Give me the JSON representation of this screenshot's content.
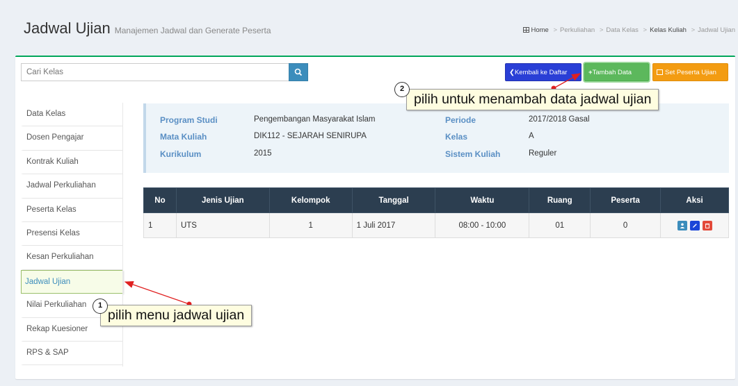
{
  "header": {
    "title": "Jadwal Ujian",
    "subtitle": "Manajemen Jadwal dan Generate Peserta",
    "breadcrumb": [
      "Home",
      "Perkuliahan",
      "Data Kelas",
      "Kelas Kuliah",
      "Jadwal Ujian"
    ],
    "breadcrumb_sep": ">"
  },
  "search": {
    "placeholder": "Cari Kelas"
  },
  "toolbar": {
    "back_label": "Kembali ke Daftar",
    "add_label": "Tambah Data",
    "set_label": "Set Peserta Ujian"
  },
  "sidebar": {
    "items": [
      {
        "label": "Data Kelas"
      },
      {
        "label": "Dosen Pengajar"
      },
      {
        "label": "Kontrak Kuliah"
      },
      {
        "label": "Jadwal Perkuliahan"
      },
      {
        "label": "Peserta Kelas"
      },
      {
        "label": "Presensi Kelas"
      },
      {
        "label": "Kesan Perkuliahan"
      },
      {
        "label": "Jadwal Ujian"
      },
      {
        "label": "Nilai Perkuliahan"
      },
      {
        "label": "Rekap Kuesioner"
      },
      {
        "label": "RPS & SAP"
      }
    ],
    "active_index": 7
  },
  "info": {
    "program_studi": {
      "label": "Program Studi",
      "value": "Pengembangan Masyarakat Islam"
    },
    "mata_kuliah": {
      "label": "Mata Kuliah",
      "value": "DIK112 - SEJARAH SENIRUPA"
    },
    "kurikulum": {
      "label": "Kurikulum",
      "value": "2015"
    },
    "periode": {
      "label": "Periode",
      "value": "2017/2018 Gasal"
    },
    "kelas": {
      "label": "Kelas",
      "value": "A"
    },
    "sistem_kuliah": {
      "label": "Sistem Kuliah",
      "value": "Reguler"
    }
  },
  "table": {
    "headers": [
      "No",
      "Jenis Ujian",
      "Kelompok",
      "Tanggal",
      "Waktu",
      "Ruang",
      "Peserta",
      "Aksi"
    ],
    "rows": [
      {
        "no": "1",
        "jenis_ujian": "UTS",
        "kelompok": "1",
        "tanggal": "1 Juli 2017",
        "waktu": "08:00 - 10:00",
        "ruang": "01",
        "peserta": "0"
      }
    ]
  },
  "callouts": [
    {
      "number": "1",
      "text": "pilih menu jadwal ujian"
    },
    {
      "number": "2",
      "text": "pilih untuk menambah data jadwal ujian"
    }
  ],
  "colors": {
    "header_bg": "#2c3e50",
    "box_border": "#00a65a",
    "btn_back": "#2a3fd6",
    "btn_add": "#5cb85c",
    "btn_set": "#f39c12",
    "callout_bg": "#fefde0",
    "arrow": "#e02020"
  }
}
